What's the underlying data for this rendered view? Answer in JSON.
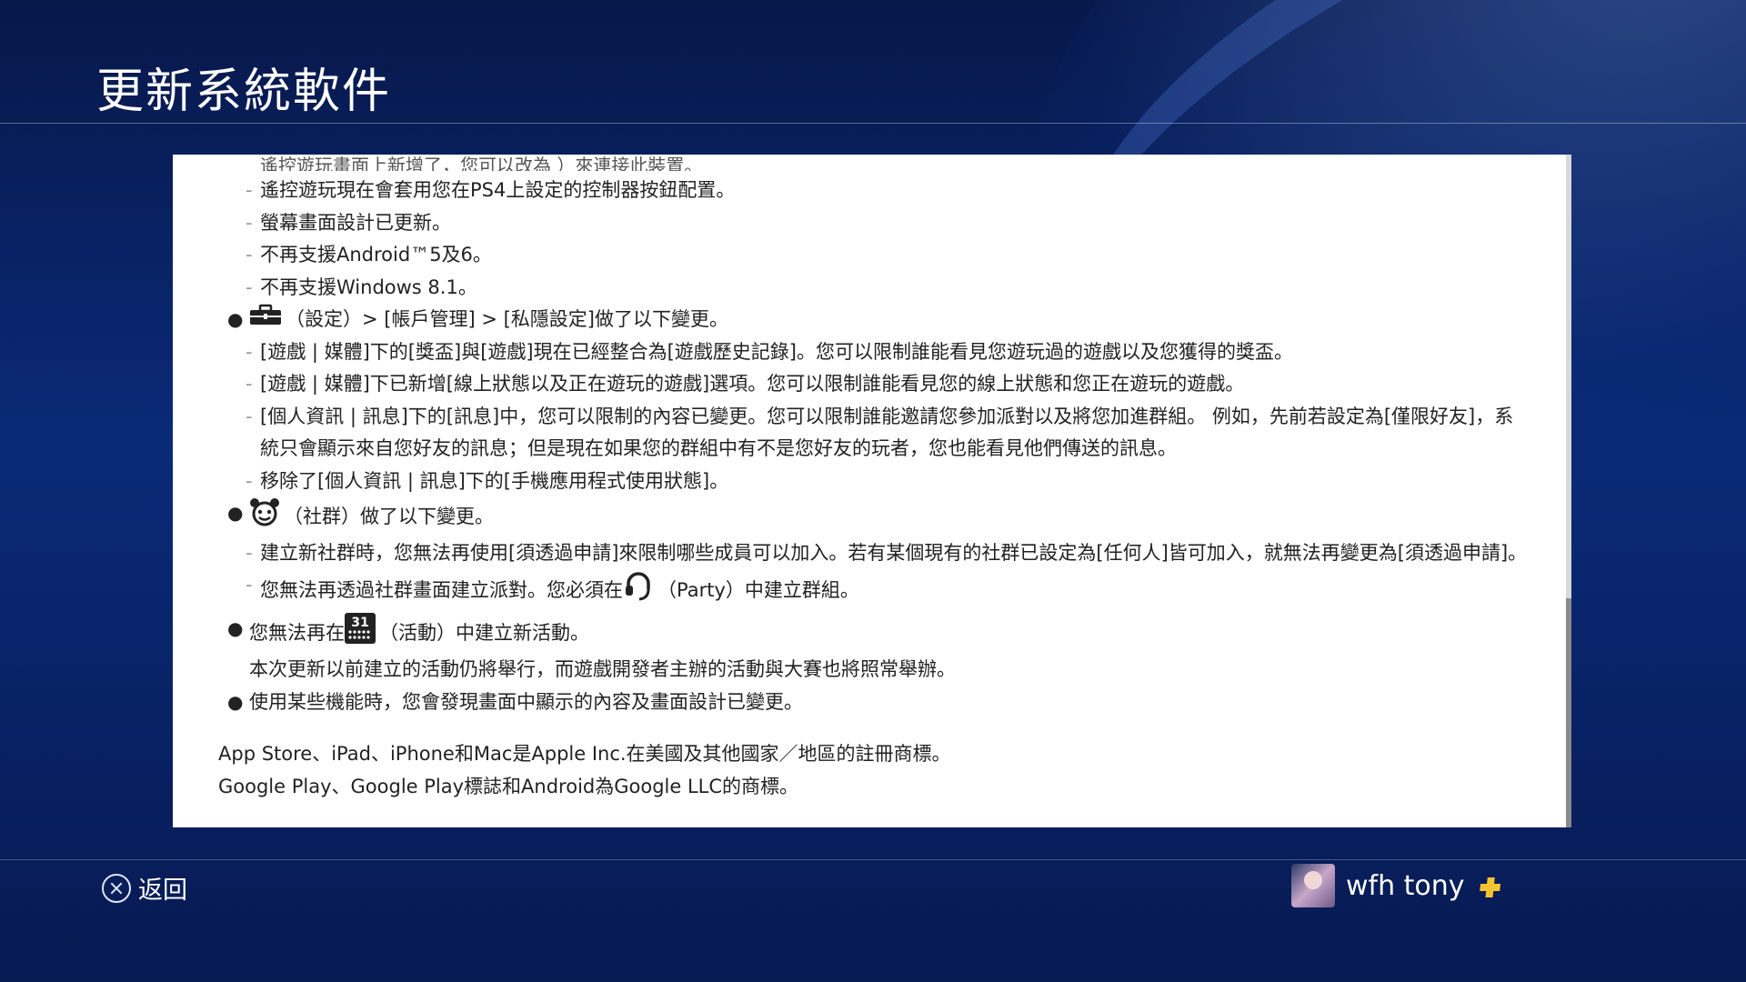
{
  "header": {
    "title": "更新系統軟件"
  },
  "document": {
    "cut_off_line": "遙控遊玩畫面上新增了，您可以改為 ）來連接此裝置。",
    "blocks": [
      {
        "kind": "sub",
        "text": "遙控遊玩現在會套用您在PS4上設定的控制器按鈕配置。"
      },
      {
        "kind": "sub",
        "text": "螢幕畫面設計已更新。"
      },
      {
        "kind": "sub",
        "text": "不再支援Android™5及6。"
      },
      {
        "kind": "sub",
        "text": "不再支援Windows 8.1。"
      },
      {
        "kind": "bullet",
        "icon": "toolbox-icon",
        "text": "（設定）> [帳戶管理] > [私隱設定]做了以下變更。"
      },
      {
        "kind": "sub",
        "text": "[遊戲 | 媒體]下的[獎盃]與[遊戲]現在已經整合為[遊戲歷史記錄]。您可以限制誰能看見您遊玩過的遊戲以及您獲得的獎盃。"
      },
      {
        "kind": "sub",
        "text": "[遊戲 | 媒體]下已新增[線上狀態以及正在遊玩的遊戲]選項。您可以限制誰能看見您的線上狀態和您正在遊玩的遊戲。"
      },
      {
        "kind": "sub",
        "text": "[個人資訊 | 訊息]下的[訊息]中，您可以限制的內容已變更。您可以限制誰能邀請您參加派對以及將您加進群組。 例如，先前若設定為[僅限好友]，系統只會顯示來自您好友的訊息；但是現在如果您的群組中有不是您好友的玩者，您也能看見他們傳送的訊息。"
      },
      {
        "kind": "sub",
        "text": "移除了[個人資訊 | 訊息]下的[手機應用程式使用狀態]。"
      },
      {
        "kind": "bullet",
        "icon": "community-icon",
        "text": "（社群）做了以下變更。"
      },
      {
        "kind": "sub",
        "text": "建立新社群時，您無法再使用[須透過申請]來限制哪些成員可以加入。若有某個現有的社群已設定為[任何人]皆可加入，就無法再變更為[須透過申請]。"
      },
      {
        "kind": "sub_party",
        "text_before": "您無法再透過社群畫面建立派對。您必須在",
        "icon": "party-headset-icon",
        "text_after": "（Party）中建立群組。"
      },
      {
        "kind": "bullet_events",
        "text_before": "您無法再在",
        "icon": "calendar-31-icon",
        "icon_label": "31",
        "text_after": "（活動）中建立新活動。"
      },
      {
        "kind": "plain",
        "text": "本次更新以前建立的活動仍將舉行，而遊戲開發者主辦的活動與大賽也將照常舉辦。"
      },
      {
        "kind": "bullet",
        "icon": "",
        "text": "使用某些機能時，您會發現畫面中顯示的內容及畫面設計已變更。"
      }
    ],
    "trademarks": [
      "App Store、iPad、iPhone和Mac是Apple Inc.在美國及其他國家／地區的註冊商標。",
      "Google Play、Google Play標誌和Android為Google LLC的商標。"
    ]
  },
  "footer": {
    "back_label": "返回",
    "user_name": "wfh tony"
  },
  "colors": {
    "plus_gold": "#f5c430",
    "background": "#0a2a78"
  }
}
